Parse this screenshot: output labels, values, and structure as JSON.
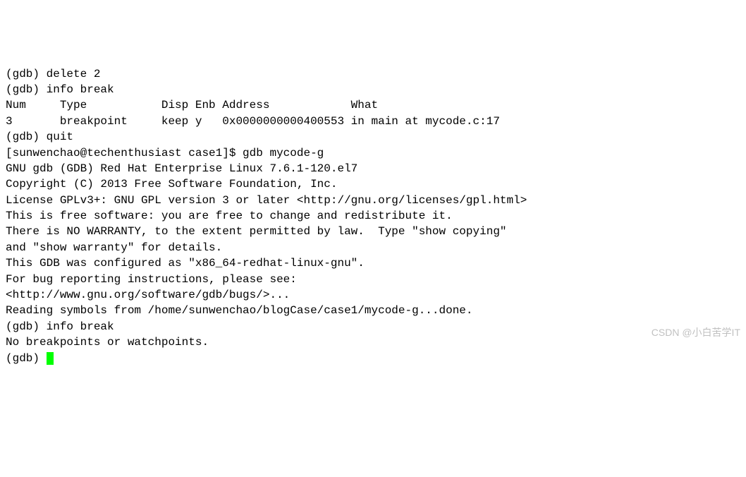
{
  "terminal": {
    "lines": [
      "(gdb) delete 2",
      "(gdb) info break",
      "Num     Type           Disp Enb Address            What",
      "3       breakpoint     keep y   0x0000000000400553 in main at mycode.c:17",
      "(gdb) quit",
      "[sunwenchao@techenthusiast case1]$ gdb mycode-g",
      "GNU gdb (GDB) Red Hat Enterprise Linux 7.6.1-120.el7",
      "Copyright (C) 2013 Free Software Foundation, Inc.",
      "License GPLv3+: GNU GPL version 3 or later <http://gnu.org/licenses/gpl.html>",
      "This is free software: you are free to change and redistribute it.",
      "There is NO WARRANTY, to the extent permitted by law.  Type \"show copying\"",
      "and \"show warranty\" for details.",
      "This GDB was configured as \"x86_64-redhat-linux-gnu\".",
      "For bug reporting instructions, please see:",
      "<http://www.gnu.org/software/gdb/bugs/>...",
      "Reading symbols from /home/sunwenchao/blogCase/case1/mycode-g...done.",
      "(gdb) info break",
      "No breakpoints or watchpoints.",
      "(gdb) "
    ]
  },
  "watermark": "CSDN @小白苦学IT"
}
